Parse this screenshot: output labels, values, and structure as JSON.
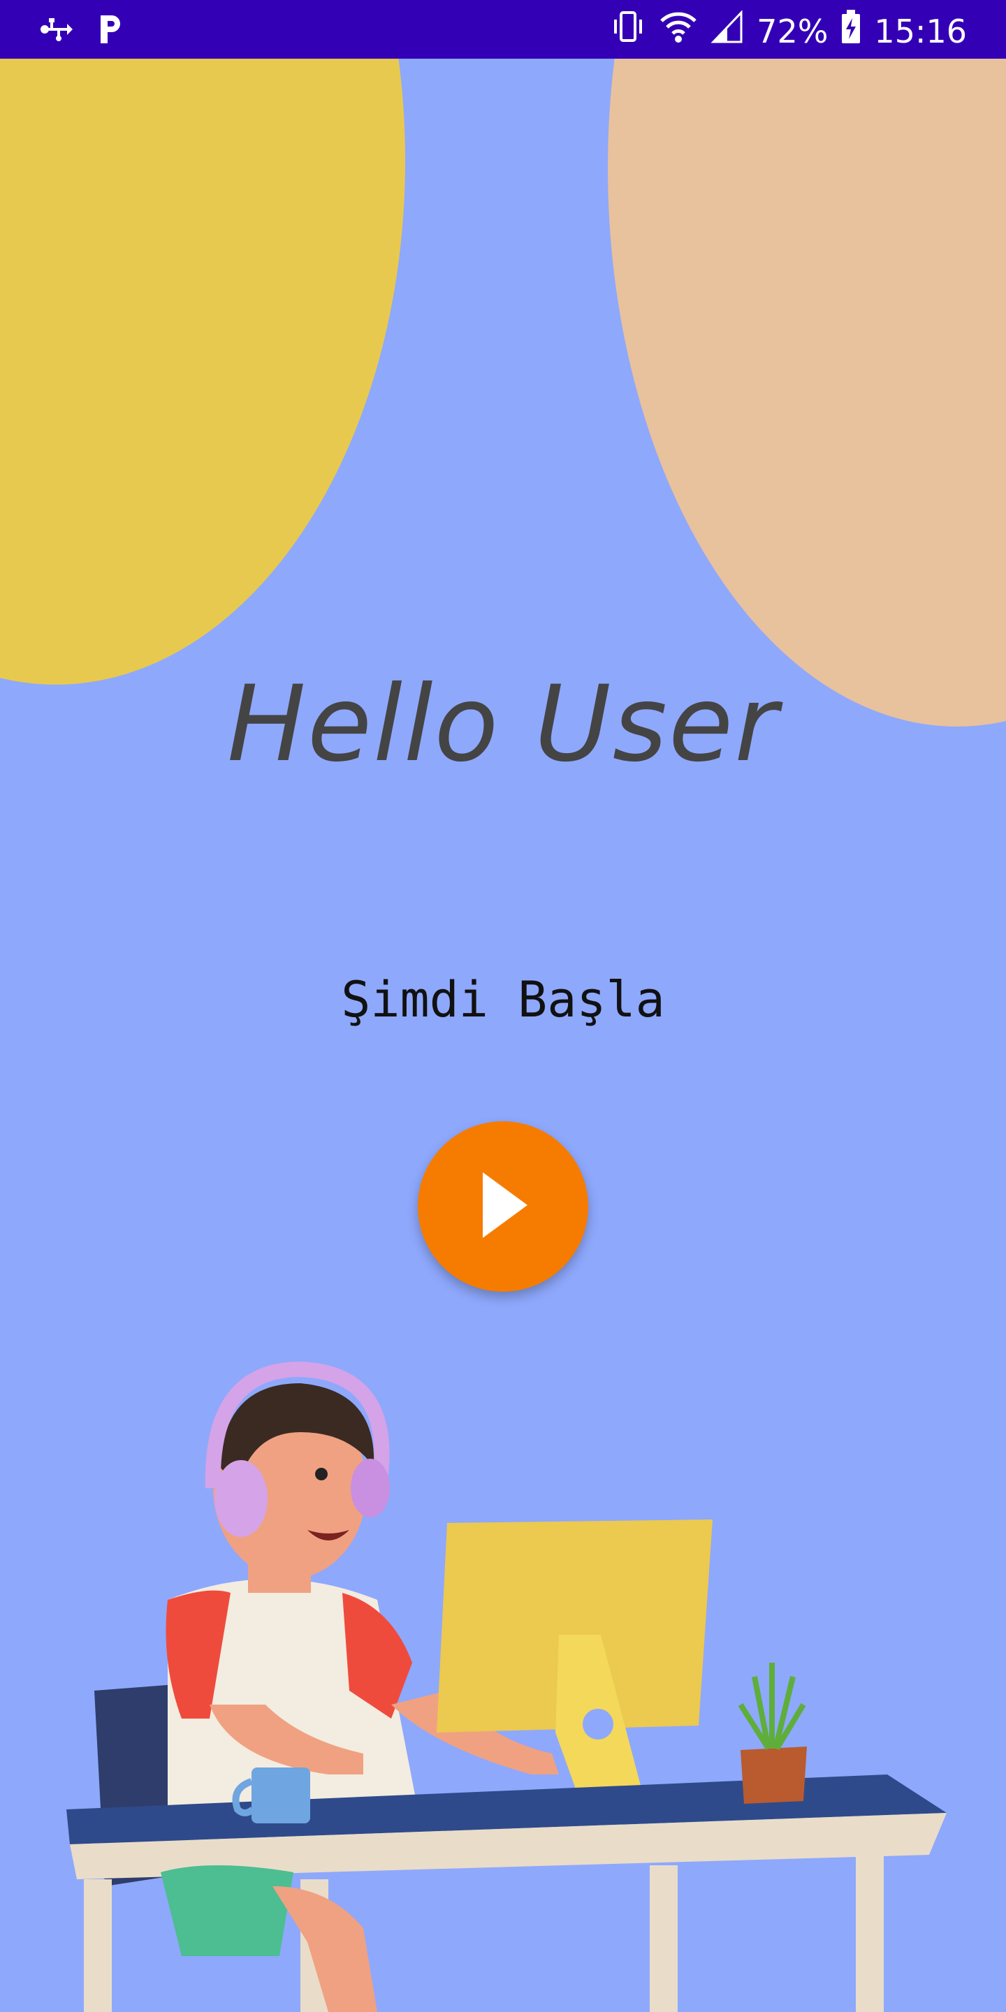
{
  "status_bar": {
    "battery_percent": "72%",
    "time": "15:16",
    "icons": [
      "usb-icon",
      "p-app-icon",
      "vibrate-icon",
      "wifi-icon",
      "signal-icon",
      "battery-icon"
    ]
  },
  "main": {
    "greeting": "Hello User",
    "start_label": "Şimdi Başla",
    "play_icon": "play-icon"
  },
  "colors": {
    "background": "#8ea8fc",
    "status_bar": "#3400b6",
    "accent": "#f57c00",
    "circle_yellow": "#e8c94f",
    "circle_peach": "#e8c19d"
  }
}
